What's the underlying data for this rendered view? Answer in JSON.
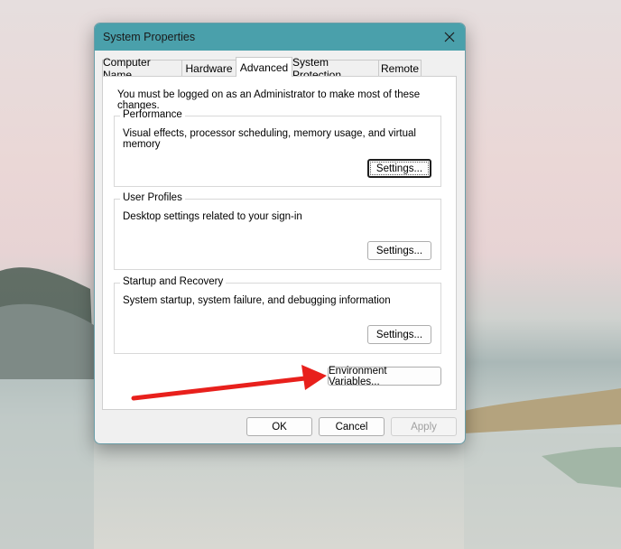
{
  "window": {
    "title": "System Properties",
    "close_icon": "close-icon"
  },
  "tabs": [
    {
      "label": "Computer Name"
    },
    {
      "label": "Hardware"
    },
    {
      "label": "Advanced",
      "active": true
    },
    {
      "label": "System Protection"
    },
    {
      "label": "Remote"
    }
  ],
  "notice": "You must be logged on as an Administrator to make most of these changes.",
  "groups": {
    "performance": {
      "title": "Performance",
      "description": "Visual effects, processor scheduling, memory usage, and virtual memory",
      "button": "Settings..."
    },
    "user_profiles": {
      "title": "User Profiles",
      "description": "Desktop settings related to your sign-in",
      "button": "Settings..."
    },
    "startup_recovery": {
      "title": "Startup and Recovery",
      "description": "System startup, system failure, and debugging information",
      "button": "Settings..."
    }
  },
  "environment_button": "Environment Variables...",
  "footer": {
    "ok": "OK",
    "cancel": "Cancel",
    "apply": "Apply"
  },
  "colors": {
    "titlebar": "#4aa0ab",
    "arrow": "#e8201c"
  }
}
